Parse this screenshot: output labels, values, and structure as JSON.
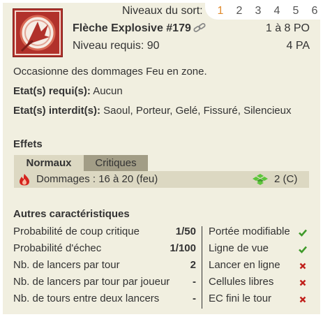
{
  "levels": {
    "label": "Niveaux du sort:",
    "items": [
      "1",
      "2",
      "3",
      "4",
      "5",
      "6"
    ],
    "active": "1",
    "active_color": "#e08a2c"
  },
  "spell": {
    "icon": "explosive-arrow-icon",
    "name": "Flèche Explosive #179",
    "link_icon": "link-icon",
    "range": "1 à 8 PO",
    "required_level": "Niveau requis: 90",
    "cost": "4 PA",
    "description": "Occasionne des dommages Feu en zone.",
    "required_states_label": "Etat(s) requi(s):",
    "required_states_value": "Aucun",
    "forbidden_states_label": "Etat(s) interdit(s):",
    "forbidden_states_value": "Saoul, Porteur, Gelé, Fissuré, Silencieux"
  },
  "effects": {
    "title": "Effets",
    "tabs": [
      "Normaux",
      "Critiques"
    ],
    "active_tab": "Normaux",
    "rows": [
      {
        "icon": "fire-icon",
        "text": "Dommages : 16 à 20 (feu)",
        "zone_icon": "zone-icon",
        "zone": "2 (C)"
      }
    ]
  },
  "characteristics": {
    "title": "Autres caractéristiques",
    "left": [
      {
        "label": "Probabilité de coup critique",
        "value": "1/50"
      },
      {
        "label": "Probabilité d'échec",
        "value": "1/100"
      },
      {
        "label": "Nb. de lancers par tour",
        "value": "2"
      },
      {
        "label": "Nb. de lancers par tour par joueur",
        "value": "-"
      },
      {
        "label": "Nb. de tours entre deux lancers",
        "value": "-"
      }
    ],
    "right": [
      {
        "label": "Portée modifiable",
        "icon": "check-icon"
      },
      {
        "label": "Ligne de vue",
        "icon": "check-icon"
      },
      {
        "label": "Lancer en ligne",
        "icon": "cross-icon"
      },
      {
        "label": "Cellules libres",
        "icon": "cross-icon"
      },
      {
        "label": "EC fini le tour",
        "icon": "cross-icon"
      }
    ]
  },
  "colors": {
    "background": "#f1efe0",
    "accent": "#e08a2c",
    "check": "#3f9a2a",
    "cross": "#c0201c"
  }
}
